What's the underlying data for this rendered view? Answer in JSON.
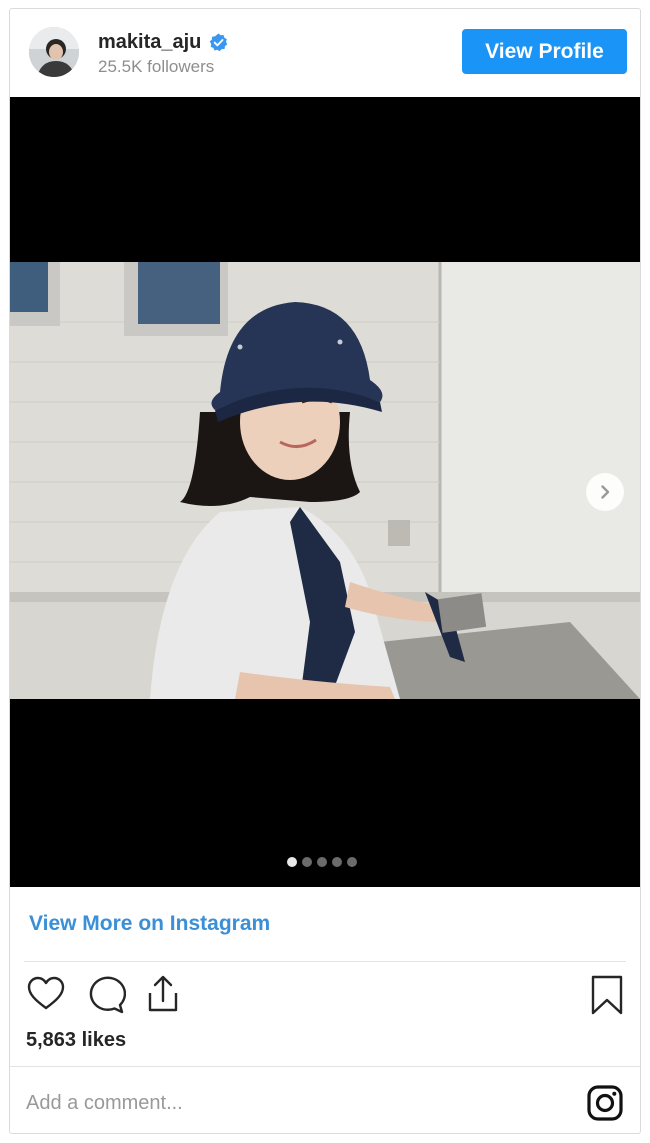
{
  "header": {
    "username": "makita_aju",
    "followers": "25.5K followers",
    "view_profile_label": "View Profile"
  },
  "media": {
    "slide_count": 5,
    "active_slide": 1
  },
  "footer": {
    "view_more_label": "View More on Instagram",
    "likes": "5,863 likes",
    "comment_placeholder": "Add a comment..."
  },
  "icons": {
    "verified": "verified-badge-icon",
    "like": "heart-icon",
    "comment": "comment-icon",
    "share": "share-icon",
    "save": "bookmark-icon",
    "next": "chevron-right-icon",
    "brand": "instagram-icon"
  },
  "colors": {
    "accent": "#1a94f6",
    "link": "#3a8fd6",
    "text": "#262626",
    "muted": "#8e8e8e"
  }
}
